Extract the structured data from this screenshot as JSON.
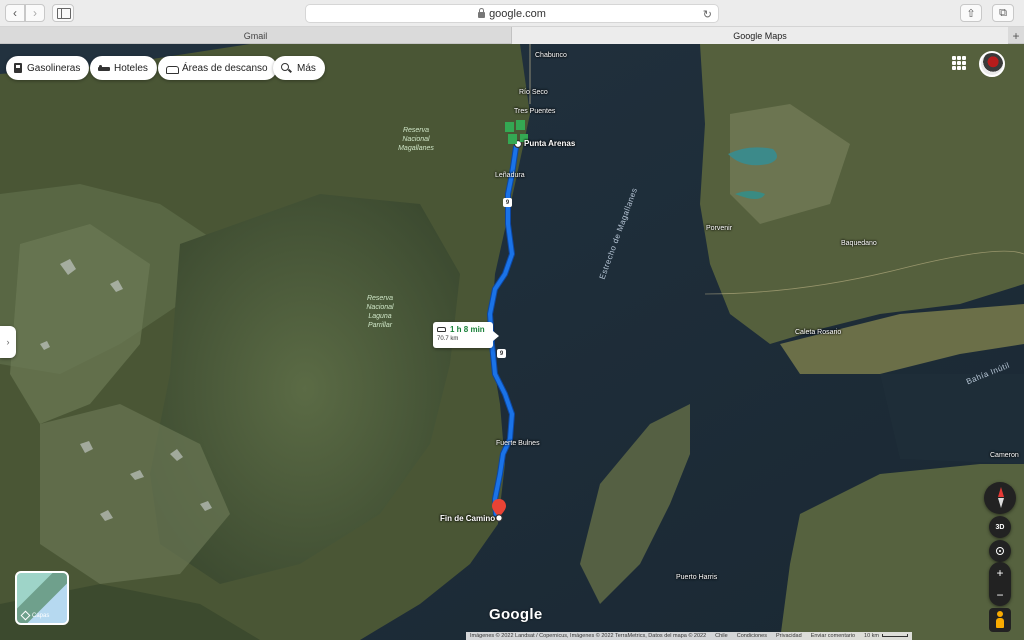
{
  "browser": {
    "url": "google.com",
    "tabs": [
      {
        "label": "Gmail"
      },
      {
        "label": "Google Maps"
      }
    ],
    "new_tab": "+"
  },
  "map": {
    "chips": [
      {
        "label": "Gasolineras",
        "icon": "gas-station-icon"
      },
      {
        "label": "Hoteles",
        "icon": "bed-icon"
      },
      {
        "label": "Áreas de descanso",
        "icon": "car-icon"
      },
      {
        "label": "Más",
        "icon": "search-icon"
      }
    ],
    "route": {
      "time": "1 h 8 min",
      "distance": "70.7 km",
      "color": "#1a73e8",
      "origin": "Punta Arenas",
      "destination": "Fin de Camino"
    },
    "places": {
      "chabunco": "Chabunco",
      "rio_seco": "Río Seco",
      "tres_puentes": "Tres Puentes",
      "punta_arenas": "Punta Arenas",
      "lenadura": "Leñadura",
      "porvenir": "Porvenir",
      "baquedano": "Baquedano",
      "caleta_rosario": "Caleta Rosario",
      "fuerte_bulnes": "Fuerte Bulnes",
      "fin_de_camino": "Fin de Camino",
      "puerto_harris": "Puerto Harris",
      "cameron": "Cameron"
    },
    "reserves": {
      "magallanes": "Reserva Nacional Magallanes",
      "laguna_parrillar": "Reserva Nacional Laguna Parrillar"
    },
    "water": {
      "estrecho": "Estrecho de Magallanes",
      "bahia_inutil": "Bahía Inútil"
    },
    "highway_shield": "9",
    "layers_label": "Capas",
    "logo": "Google",
    "controls": {
      "three_d": "3D",
      "zoom_in": "+",
      "zoom_out": "−"
    },
    "footer": {
      "attribution": "Imágenes © 2022 Landsat / Copernicus, Imágenes © 2022 TerraMetrics, Datos del mapa © 2022",
      "country": "Chile",
      "terms": "Condiciones",
      "feedback": "Enviar comentario",
      "privacy": "Privacidad",
      "scale": "10 km"
    }
  }
}
